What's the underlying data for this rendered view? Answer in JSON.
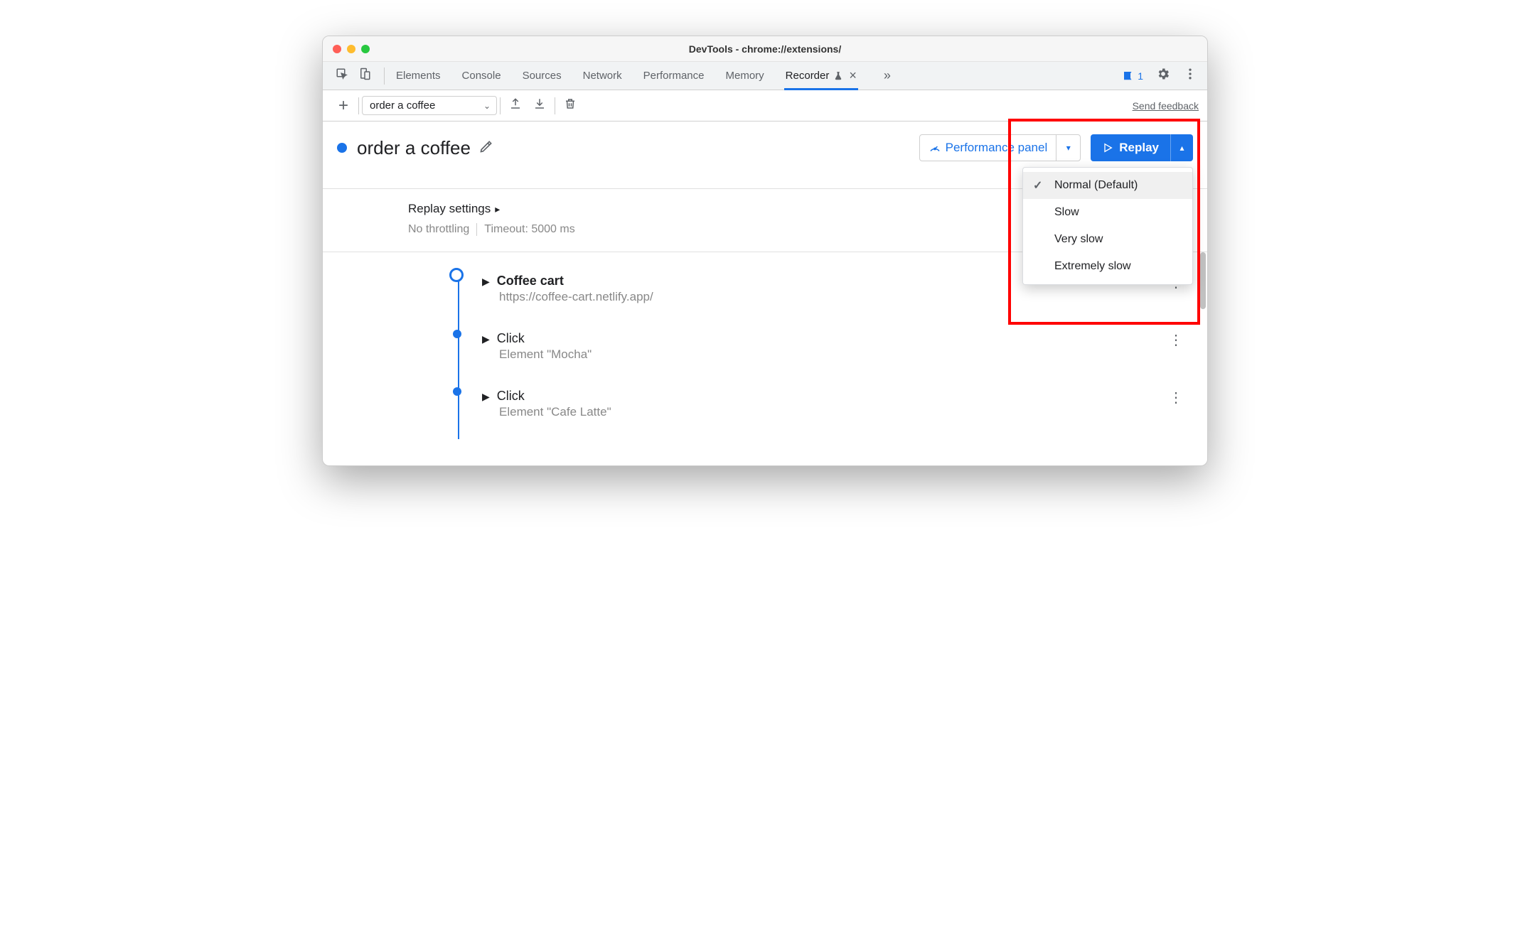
{
  "window": {
    "title": "DevTools - chrome://extensions/"
  },
  "tabs": {
    "items": [
      "Elements",
      "Console",
      "Sources",
      "Network",
      "Performance",
      "Memory"
    ],
    "active": {
      "label": "Recorder"
    }
  },
  "issues_count": "1",
  "toolbar": {
    "recording_name": "order a coffee",
    "feedback": "Send feedback"
  },
  "header": {
    "title": "order a coffee",
    "perf_panel": "Performance panel",
    "replay": "Replay"
  },
  "replay_menu": {
    "options": [
      "Normal (Default)",
      "Slow",
      "Very slow",
      "Extremely slow"
    ],
    "selected_index": 0
  },
  "settings": {
    "title": "Replay settings",
    "throttling": "No throttling",
    "timeout": "Timeout: 5000 ms"
  },
  "steps": [
    {
      "title": "Coffee cart",
      "subtitle": "https://coffee-cart.netlify.app/",
      "first": true
    },
    {
      "title": "Click",
      "subtitle": "Element \"Mocha\""
    },
    {
      "title": "Click",
      "subtitle": "Element \"Cafe Latte\""
    }
  ]
}
